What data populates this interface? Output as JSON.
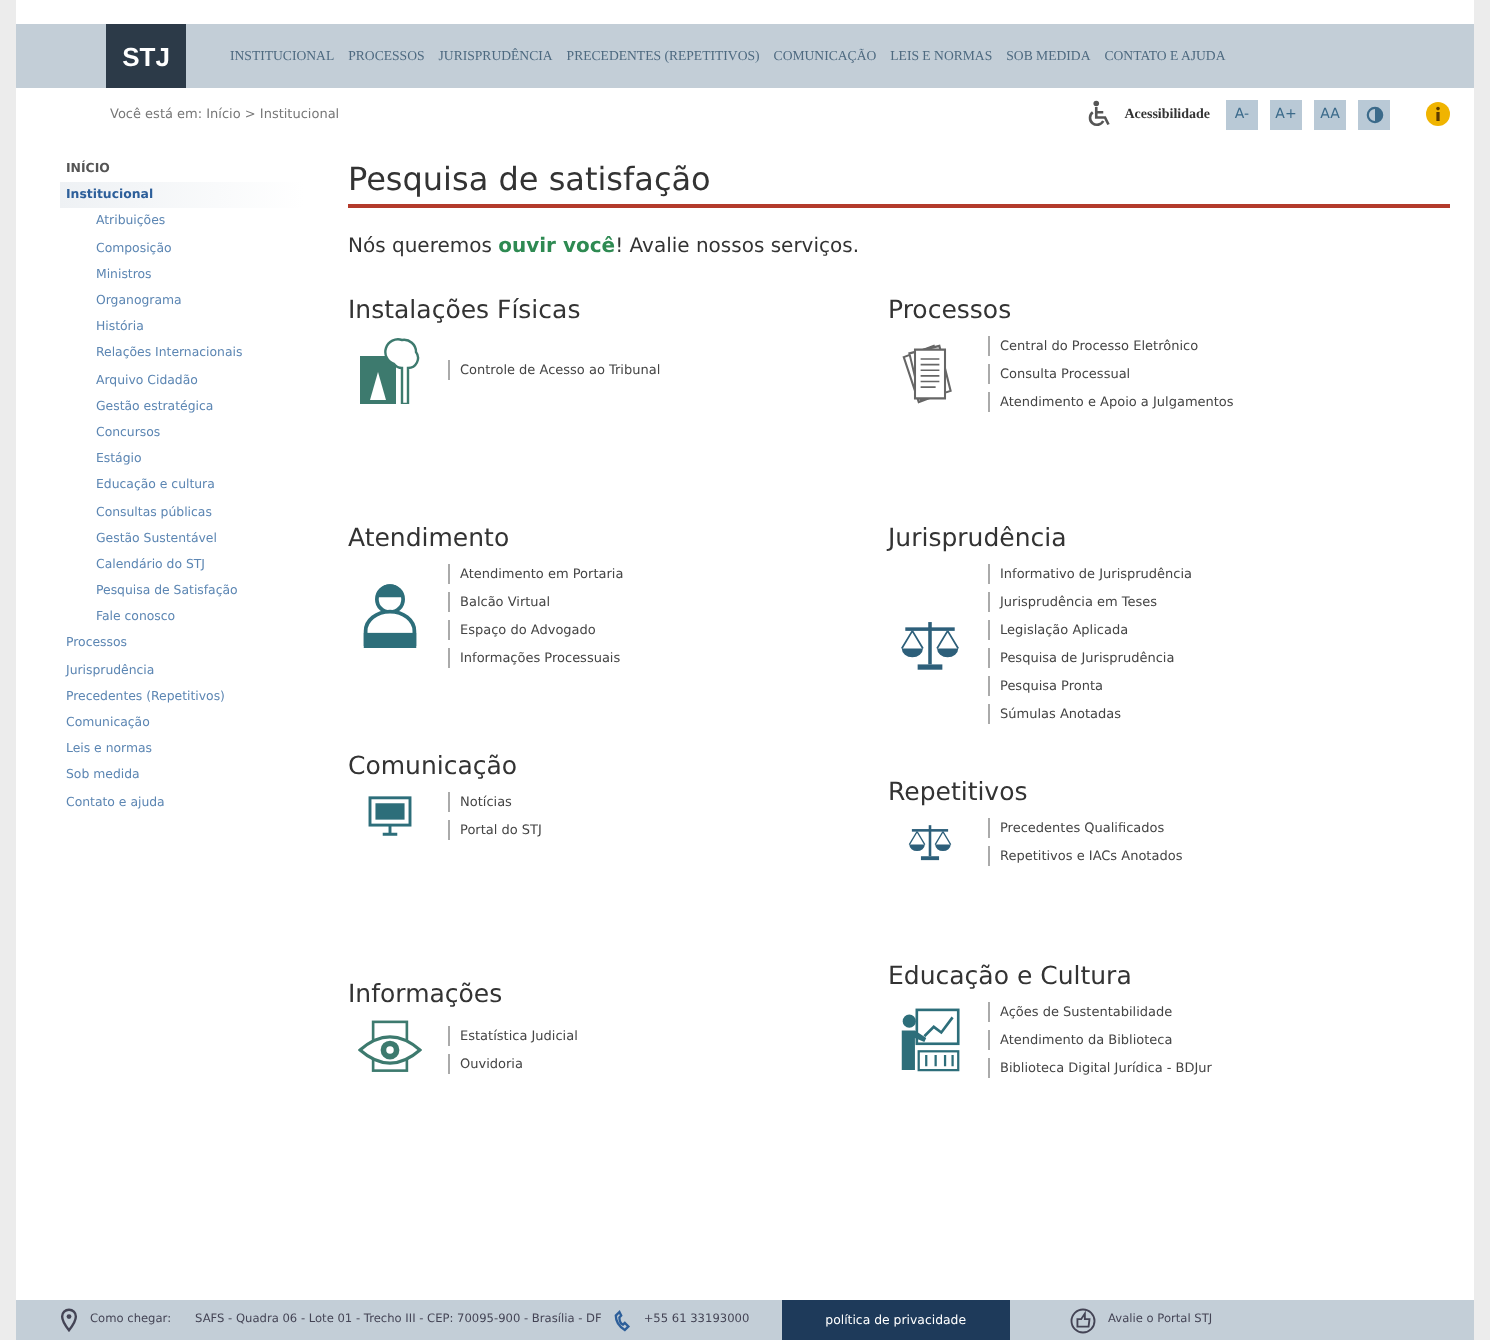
{
  "logo": "STJ",
  "nav": [
    "INSTITUCIONAL",
    "PROCESSOS",
    "JURISPRUDÊNCIA",
    "PRECEDENTES (REPETITIVOS)",
    "COMUNICAÇÃO",
    "LEIS E NORMAS",
    "SOB MEDIDA",
    "CONTATO E AJUDA"
  ],
  "breadcrumb": "Você está em: Início > Institucional",
  "accessibility": {
    "label": "Acessibilidade",
    "buttons": [
      "A-",
      "A+",
      "AA"
    ]
  },
  "sidebar": {
    "items": [
      {
        "label": "INÍCIO",
        "selected": false
      },
      {
        "label": "Institucional",
        "selected": true,
        "children": [
          {
            "label": "Atribuições",
            "selected": false
          },
          {
            "label": "Composição",
            "selected": false
          },
          {
            "label": "Ministros",
            "selected": false
          },
          {
            "label": "Organograma",
            "selected": false
          },
          {
            "label": "História",
            "selected": false
          },
          {
            "label": "Relações Internacionais",
            "selected": false
          },
          {
            "label": "Arquivo Cidadão",
            "selected": false
          },
          {
            "label": "Gestão estratégica",
            "selected": false
          },
          {
            "label": "Concursos",
            "selected": false
          },
          {
            "label": "Estágio",
            "selected": false
          },
          {
            "label": "Educação e cultura",
            "selected": false
          },
          {
            "label": "Consultas públicas",
            "selected": false
          },
          {
            "label": "Gestão Sustentável",
            "selected": false
          },
          {
            "label": "Calendário do STJ",
            "selected": false
          },
          {
            "label": "Pesquisa de Satisfação",
            "selected": false
          },
          {
            "label": "Fale conosco",
            "selected": false
          }
        ]
      },
      {
        "label": "Processos",
        "selected": false
      },
      {
        "label": "Jurisprudência",
        "selected": false
      },
      {
        "label": "Precedentes (Repetitivos)",
        "selected": false
      },
      {
        "label": "Comunicação",
        "selected": false
      },
      {
        "label": "Leis e normas",
        "selected": false
      },
      {
        "label": "Sob medida",
        "selected": false
      },
      {
        "label": "Contato e ajuda",
        "selected": false
      }
    ]
  },
  "page_title": "Pesquisa de satisfação",
  "intro": "Nós queremos **ouvir você**! Avalie nossos serviços.",
  "columns": [
    [
      {
        "title": "Instalações Físicas",
        "kind": "building",
        "links": [
          "Controle de Acesso ao Tribunal"
        ]
      },
      {
        "title": "Atendimento",
        "kind": "attendant",
        "links": [
          "Atendimento em Portaria",
          "Balcão Virtual",
          "Espaço do Advogado",
          "Informações Processuais"
        ]
      },
      {
        "title": "Comunicação",
        "kind": "monitor",
        "links": [
          "Notícias",
          "Portal do STJ"
        ]
      },
      {
        "title": "Informações",
        "kind": "eye",
        "links": [
          "Estatística Judicial",
          "Ouvidoria"
        ]
      }
    ],
    [
      {
        "title": "Processos",
        "kind": "documents",
        "links": [
          "Central do Processo Eletrônico",
          "Consulta Processual",
          "Atendimento e Apoio a Julgamentos"
        ]
      },
      {
        "title": "Jurisprudência",
        "kind": "scale",
        "links": [
          "Informativo de Jurisprudência",
          "Jurisprudência em Teses",
          "Legislação Aplicada",
          "Pesquisa de Jurisprudência",
          "Pesquisa Pronta",
          "Súmulas Anotadas"
        ]
      },
      {
        "title": "Repetitivos",
        "kind": "scale-small",
        "links": [
          "Precedentes Qualificados",
          "Repetitivos e IACs Anotados"
        ]
      },
      {
        "title": "Educação e Cultura",
        "kind": "teacher",
        "links": [
          "Ações de Sustentabilidade",
          "Atendimento da Biblioteca",
          "Biblioteca Digital Jurídica - BDJur"
        ]
      }
    ]
  ],
  "footer": {
    "directions_label": "Como chegar:",
    "address": "SAFS - Quadra 06 - Lote 01 - Trecho III - CEP: 70095-900 - Brasília - DF",
    "phone": "+55 61 33193000",
    "privacy": "política de privacidade",
    "rate": "Avalie o Portal STJ"
  }
}
